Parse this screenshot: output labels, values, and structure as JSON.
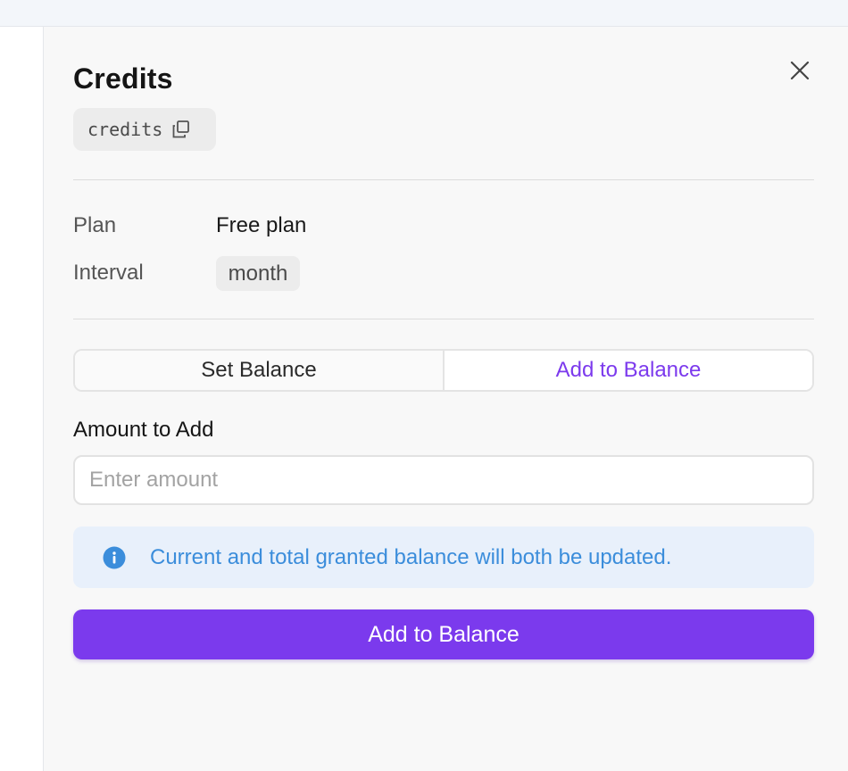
{
  "panel": {
    "title": "Credits",
    "feature_id": "credits",
    "close_icon": "close-icon",
    "copy_icon": "copy-icon"
  },
  "details": {
    "plan_label": "Plan",
    "plan_value": "Free plan",
    "interval_label": "Interval",
    "interval_value": "month"
  },
  "mode_toggle": {
    "options": [
      "Set Balance",
      "Add to Balance"
    ],
    "selected": "Add to Balance"
  },
  "amount": {
    "label": "Amount to Add",
    "placeholder": "Enter amount",
    "value": ""
  },
  "info": {
    "icon": "info-icon",
    "text": "Current and total granted balance will both be updated."
  },
  "submit": {
    "label": "Add to Balance"
  },
  "colors": {
    "accent": "#7b3aed",
    "info_text": "#3b8ddb",
    "info_bg": "#e8f0fb"
  }
}
